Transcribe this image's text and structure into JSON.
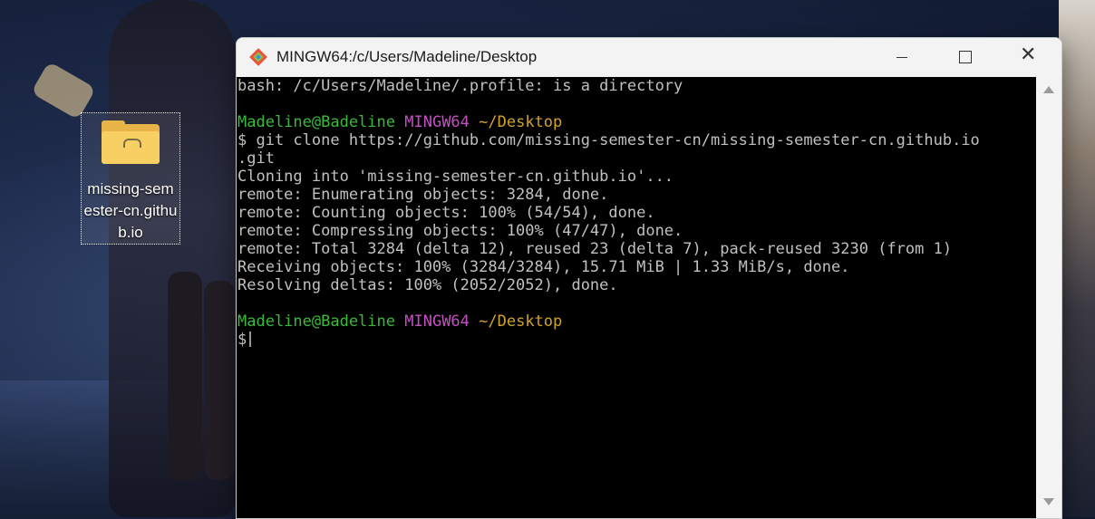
{
  "desktop": {
    "icon_label": "missing-semester-cn.github.io"
  },
  "window": {
    "title": "MINGW64:/c/Users/Madeline/Desktop",
    "icons": {
      "app": "git-icon",
      "minimize": "minimize-icon",
      "maximize": "maximize-icon",
      "close": "close-icon"
    }
  },
  "terminal": {
    "lines": [
      "bash: /c/Users/Madeline/.profile: is a directory",
      "",
      "",
      "$ git clone https://github.com/missing-semester-cn/missing-semester-cn.github.io",
      ".git",
      "Cloning into 'missing-semester-cn.github.io'...",
      "remote: Enumerating objects: 3284, done.",
      "remote: Counting objects: 100% (54/54), done.",
      "remote: Compressing objects: 100% (47/47), done.",
      "remote: Total 3284 (delta 12), reused 23 (delta 7), pack-reused 3230 (from 1)",
      "Receiving objects: 100% (3284/3284), 15.71 MiB | 1.33 MiB/s, done.",
      "Resolving deltas: 100% (2052/2052), done."
    ],
    "prompt1": {
      "user_host": "Madeline@Badeline",
      "system": "MINGW64",
      "path": "~/Desktop"
    },
    "prompt2": {
      "user_host": "Madeline@Badeline",
      "system": "MINGW64",
      "path": "~/Desktop"
    },
    "input_prompt": "$",
    "colors": {
      "user_host": "#3ab93a",
      "system": "#c54fc5",
      "path": "#d0a327",
      "text": "#c0c0c0",
      "background": "#000000"
    }
  }
}
